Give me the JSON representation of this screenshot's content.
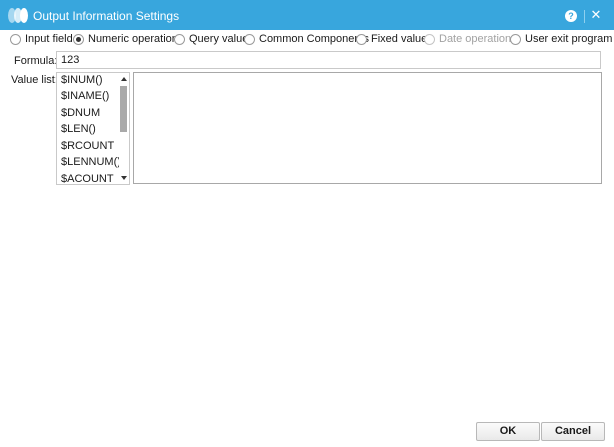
{
  "window": {
    "title": "Output Information Settings",
    "help_glyph": "?",
    "close_glyph": "✕"
  },
  "radio_options": [
    {
      "label": "Input field",
      "selected": false,
      "disabled": false
    },
    {
      "label": "Numeric operations",
      "selected": true,
      "disabled": false
    },
    {
      "label": "Query value",
      "selected": false,
      "disabled": false
    },
    {
      "label": "Common Components",
      "selected": false,
      "disabled": false
    },
    {
      "label": "Fixed value",
      "selected": false,
      "disabled": false
    },
    {
      "label": "Date operations",
      "selected": false,
      "disabled": true
    },
    {
      "label": "User exit program",
      "selected": false,
      "disabled": false
    }
  ],
  "formula": {
    "label": "Formula:",
    "value": "123"
  },
  "value_list": {
    "label": "Value list:",
    "items": [
      "$INUM()",
      "$INAME()",
      "$DNUM",
      "$LEN()",
      "$RCOUNT",
      "$LENNUM()",
      "$ACOUNT"
    ]
  },
  "buttons": {
    "ok": "OK",
    "cancel": "Cancel"
  },
  "colors": {
    "titlebar": "#38a6dd"
  }
}
